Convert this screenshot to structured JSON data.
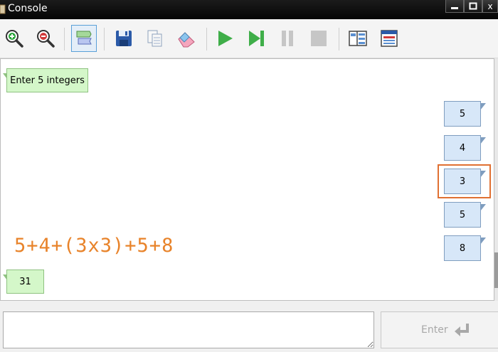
{
  "window": {
    "title": "Console",
    "minimize_glyph": "▬",
    "maximize_glyph": "◻",
    "close_glyph": "x"
  },
  "toolbar": {
    "buttons": [
      {
        "icon": "zoom-in-icon"
      },
      {
        "icon": "zoom-out-icon"
      },
      {
        "icon": "flag-icon",
        "active": true
      },
      {
        "icon": "save-icon"
      },
      {
        "icon": "copy-icon"
      },
      {
        "icon": "eraser-icon"
      },
      {
        "icon": "run-icon"
      },
      {
        "icon": "step-icon"
      },
      {
        "icon": "pause-icon"
      },
      {
        "icon": "stop-icon"
      },
      {
        "icon": "layout-columns-icon"
      },
      {
        "icon": "layout-window-icon"
      }
    ]
  },
  "console": {
    "prompt": "Enter 5 integers",
    "inputs": [
      "5",
      "4",
      "3",
      "5",
      "8"
    ],
    "highlighted_input_index": 2,
    "expression": "5+4+(3x3)+5+8",
    "result": "31"
  },
  "input": {
    "value": "",
    "enter_label": "Enter"
  },
  "colors": {
    "output_bubble": "#d4f7c9",
    "input_bubble": "#d7e7f8",
    "highlight": "#e07032",
    "expression": "#e8832a"
  }
}
